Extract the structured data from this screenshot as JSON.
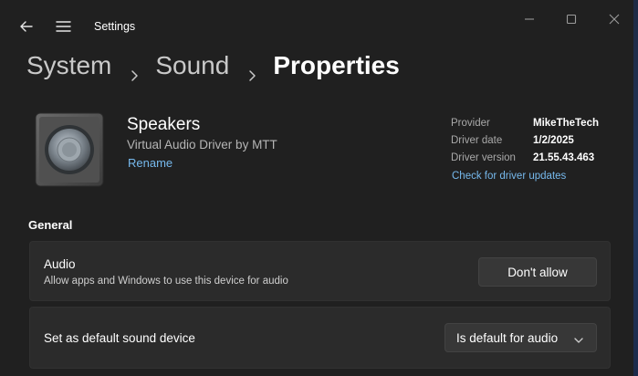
{
  "window": {
    "title": "Settings"
  },
  "breadcrumb": {
    "items": [
      "System",
      "Sound"
    ],
    "current": "Properties"
  },
  "device": {
    "name": "Speakers",
    "description": "Virtual Audio Driver by MTT",
    "rename_label": "Rename"
  },
  "driver_info": {
    "provider_label": "Provider",
    "provider_value": "MikeTheTech",
    "date_label": "Driver date",
    "date_value": "1/2/2025",
    "version_label": "Driver version",
    "version_value": "21.55.43.463",
    "check_updates_label": "Check for driver updates"
  },
  "general": {
    "title": "General",
    "audio": {
      "title": "Audio",
      "description": "Allow apps and Windows to use this device for audio",
      "button_label": "Don't allow"
    },
    "default_device": {
      "title": "Set as default sound device",
      "selected": "Is default for audio"
    }
  },
  "icons": [
    "back-arrow-icon",
    "hamburger-menu-icon",
    "minimize-icon",
    "maximize-icon",
    "close-icon",
    "chevron-right-icon",
    "speaker-icon",
    "chevron-down-icon"
  ],
  "colors": {
    "window_bg": "#202020",
    "card_bg": "#2b2b2b",
    "link": "#76b9ed",
    "button_bg": "#373737"
  }
}
